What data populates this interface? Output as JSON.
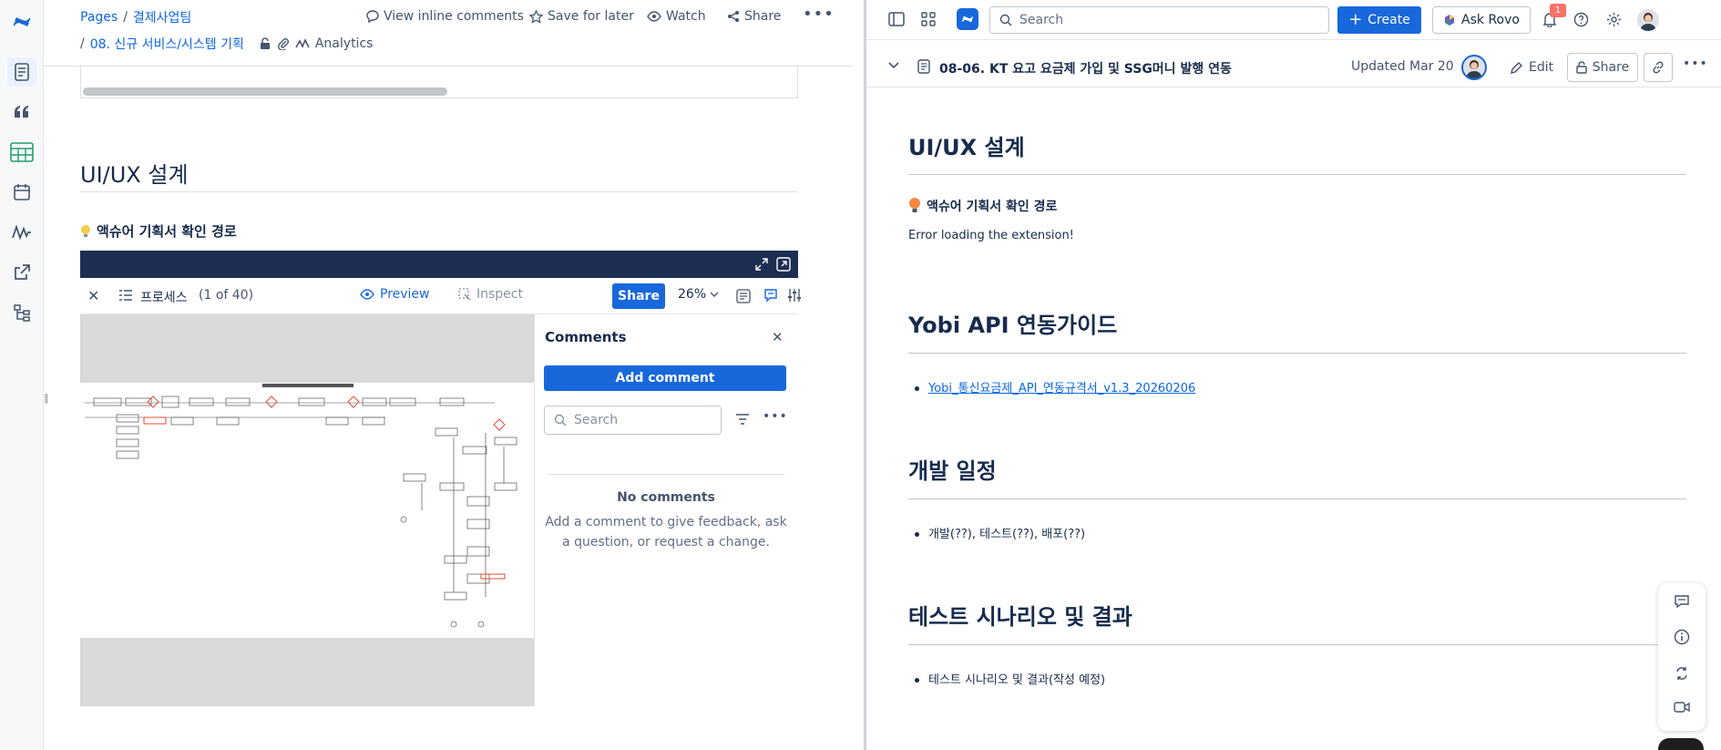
{
  "left": {
    "breadcrumb": {
      "pages": "Pages",
      "sep1": "/",
      "space": "결제사업팀",
      "sep2": "/",
      "parent": "08. 신규 서비스/시스템 기획"
    },
    "toolbar": {
      "inline_comments": "View inline comments",
      "save_later": "Save for later",
      "watch": "Watch",
      "share": "Share",
      "analytics": "Analytics"
    },
    "heading": "UI/UX 설계",
    "callout": "액슈어 기획서 확인 경로",
    "viewer": {
      "page_label": "프로세스",
      "page_count": "(1 of 40)",
      "preview": "Preview",
      "inspect": "Inspect",
      "share": "Share",
      "zoom": "26%"
    },
    "comments": {
      "title": "Comments",
      "add_comment": "Add comment",
      "search_placeholder": "Search",
      "empty_title": "No comments",
      "empty_line1": "Add a comment to give feedback, ask",
      "empty_line2": "a question, or request a change."
    }
  },
  "right": {
    "topbar": {
      "search_placeholder": "Search",
      "create": "Create",
      "ask_rovo": "Ask Rovo",
      "notification_count": "1"
    },
    "page_header": {
      "title": "08-06. KT 요고 요금제 가입 및 SSG머니 발행 연동",
      "updated": "Updated Mar 20",
      "edit": "Edit",
      "share": "Share"
    },
    "sections": [
      {
        "heading": "UI/UX 설계"
      },
      {
        "heading": "Yobi API 연동가이드"
      },
      {
        "heading": "개발 일정"
      },
      {
        "heading": "테스트 시나리오 및 결과"
      }
    ],
    "callout": "액슈어 기획서 확인 경로",
    "error_text": "Error loading the extension!",
    "link": "Yobi_통신요금제_API_연동규격서_v1.3_20260206",
    "schedule_item": "개발(??), 테스트(??), 배포(??)",
    "test_item": "테스트 시나리오 및 결과(작성 예정)"
  },
  "colors": {
    "brand": "#1868db",
    "link": "#0c66e4",
    "header_dark": "#1d2e52",
    "danger": "#e34935"
  }
}
